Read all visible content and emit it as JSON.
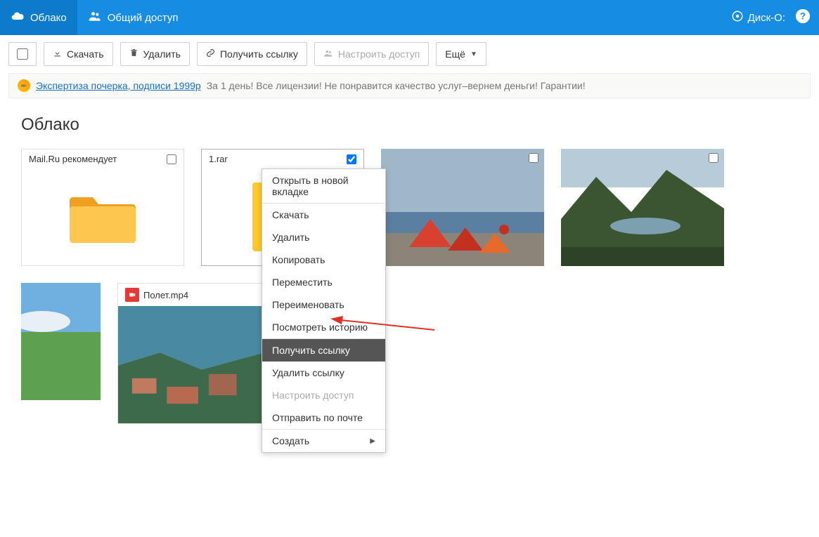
{
  "topbar": {
    "tab_cloud": "Облако",
    "tab_shared": "Общий доступ",
    "disk_o": "Диск-О:"
  },
  "toolbar": {
    "download": "Скачать",
    "delete": "Удалить",
    "get_link": "Получить ссылку",
    "configure_access": "Настроить доступ",
    "more": "Ещё"
  },
  "ad": {
    "link_text": "Экспертиза почерка, подписи 1999р",
    "tail": "За 1 день! Все лицензии! Не понравится качество услуг–вернем деньги! Гарантии!"
  },
  "page_title": "Облако",
  "files": {
    "recommended": "Mail.Ru рекомендует",
    "rar": "1.rar",
    "video": "Полет.mp4"
  },
  "context_menu": {
    "open_new_tab": "Открыть в новой вкладке",
    "download": "Скачать",
    "delete": "Удалить",
    "copy": "Копировать",
    "move": "Переместить",
    "rename": "Переименовать",
    "history": "Посмотреть историю",
    "get_link": "Получить ссылку",
    "remove_link": "Удалить ссылку",
    "configure_access": "Настроить доступ",
    "send_mail": "Отправить по почте",
    "create": "Создать"
  }
}
